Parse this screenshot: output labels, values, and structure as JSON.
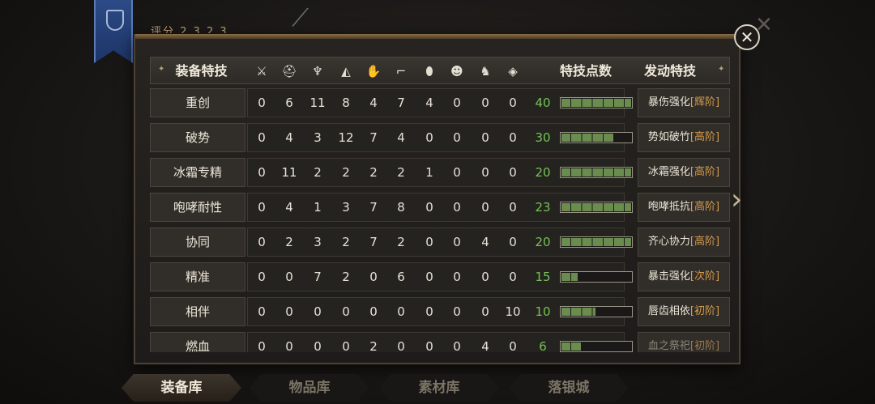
{
  "background": {
    "score_label": "评分 2 3 2 3"
  },
  "header": {
    "col_name": "装备特技",
    "col_points": "特技点数",
    "col_skill": "发动特技",
    "slot_icons": [
      {
        "name": "sword-icon",
        "glyph": "⚔"
      },
      {
        "name": "helmet-icon",
        "glyph": "⛑"
      },
      {
        "name": "armor-icon",
        "glyph": "♆"
      },
      {
        "name": "pauldron-icon",
        "glyph": "◭"
      },
      {
        "name": "gauntlet-icon",
        "glyph": "✋"
      },
      {
        "name": "boots-icon",
        "glyph": "⌐"
      },
      {
        "name": "shield-icon",
        "glyph": "⬮"
      },
      {
        "name": "mask-icon",
        "glyph": "☻"
      },
      {
        "name": "horse-icon",
        "glyph": "♞"
      },
      {
        "name": "gem-icon",
        "glyph": "◈"
      }
    ]
  },
  "rows": [
    {
      "name": "重创",
      "values": [
        "0",
        "6",
        "11",
        "8",
        "4",
        "7",
        "4",
        "0",
        "0",
        "0"
      ],
      "points": "40",
      "fill": 1.0,
      "skill": "暴伤强化",
      "tier": "[辉阶]",
      "dim": false
    },
    {
      "name": "破势",
      "values": [
        "0",
        "4",
        "3",
        "12",
        "7",
        "4",
        "0",
        "0",
        "0",
        "0"
      ],
      "points": "30",
      "fill": 0.75,
      "skill": "势如破竹",
      "tier": "[高阶]",
      "dim": false
    },
    {
      "name": "冰霜专精",
      "values": [
        "0",
        "11",
        "2",
        "2",
        "2",
        "2",
        "1",
        "0",
        "0",
        "0"
      ],
      "points": "20",
      "fill": 1.0,
      "skill": "冰霜强化",
      "tier": "[高阶]",
      "dim": false
    },
    {
      "name": "咆哮耐性",
      "values": [
        "0",
        "4",
        "1",
        "3",
        "7",
        "8",
        "0",
        "0",
        "0",
        "0"
      ],
      "points": "23",
      "fill": 1.0,
      "skill": "咆哮抵抗",
      "tier": "[高阶]",
      "dim": false
    },
    {
      "name": "协同",
      "values": [
        "0",
        "2",
        "3",
        "2",
        "7",
        "2",
        "0",
        "0",
        "4",
        "0"
      ],
      "points": "20",
      "fill": 1.0,
      "skill": "齐心协力",
      "tier": "[高阶]",
      "dim": false
    },
    {
      "name": "精准",
      "values": [
        "0",
        "0",
        "7",
        "2",
        "0",
        "6",
        "0",
        "0",
        "0",
        "0"
      ],
      "points": "15",
      "fill": 0.25,
      "skill": "暴击强化",
      "tier": "[次阶]",
      "dim": false
    },
    {
      "name": "相伴",
      "values": [
        "0",
        "0",
        "0",
        "0",
        "0",
        "0",
        "0",
        "0",
        "0",
        "10"
      ],
      "points": "10",
      "fill": 0.5,
      "skill": "唇齿相依",
      "tier": "[初阶]",
      "dim": false
    },
    {
      "name": "燃血",
      "values": [
        "0",
        "0",
        "0",
        "0",
        "2",
        "0",
        "0",
        "0",
        "4",
        "0"
      ],
      "points": "6",
      "fill": 0.3,
      "skill": "血之祭祀",
      "tier": "[初阶]",
      "dim": true
    }
  ],
  "tabs": [
    "装备库",
    "物品库",
    "素材库",
    "落银城"
  ],
  "active_tab": 0,
  "colors": {
    "points_green": "#73c254",
    "tier_orange": "#d49a4c",
    "bar_fill": "#6b8c4f"
  }
}
